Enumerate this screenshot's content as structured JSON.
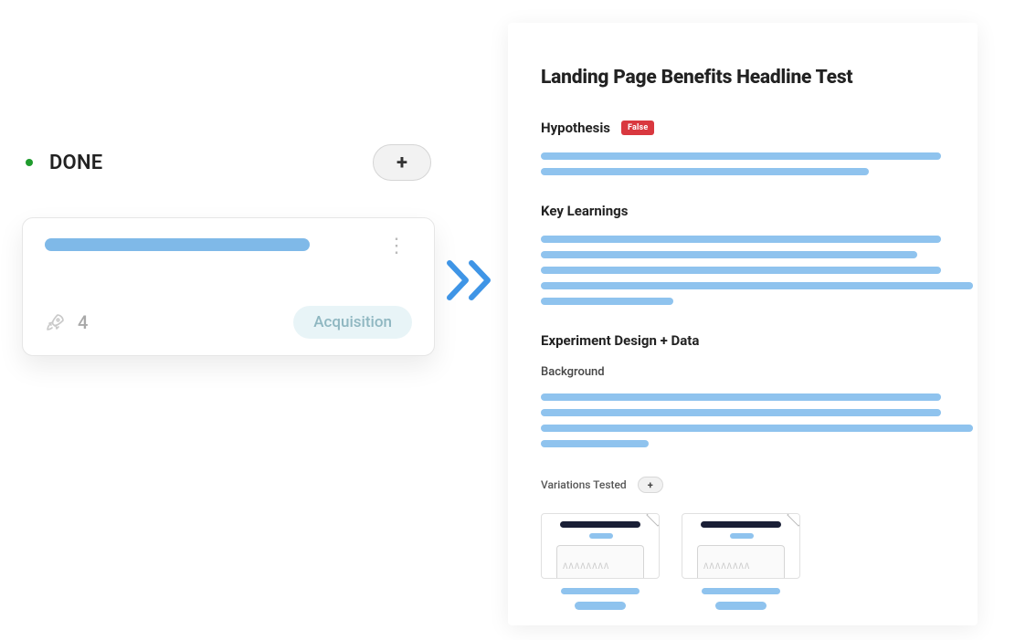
{
  "column": {
    "title": "DONE",
    "status_color": "#1f9b2d",
    "add_label": "+"
  },
  "card": {
    "title_placeholder": true,
    "score": "4",
    "tag": "Acquisition"
  },
  "detail": {
    "title": "Landing Page Benefits Headline Test",
    "hypothesis": {
      "label": "Hypothesis",
      "badge": "False",
      "lines": [
        100,
        80
      ]
    },
    "key_learnings": {
      "label": "Key Learnings",
      "lines": [
        100,
        96,
        100,
        104,
        33
      ]
    },
    "experiment": {
      "label": "Experiment Design + Data",
      "background_label": "Background",
      "lines": [
        100,
        100,
        108,
        27
      ]
    },
    "variations": {
      "label": "Variations Tested",
      "add_label": "+",
      "count": 2
    }
  }
}
